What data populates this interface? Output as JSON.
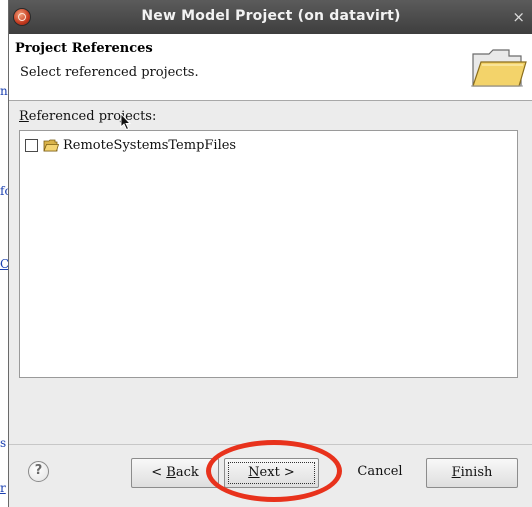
{
  "window": {
    "title": "New Model Project  (on datavirt)",
    "close_glyph": "×"
  },
  "header": {
    "title": "Project References",
    "description": "Select referenced projects."
  },
  "content": {
    "label_mnemonic": "R",
    "label_rest": "eferenced projects:",
    "projects": [
      {
        "name": "RemoteSystemsTempFiles",
        "checked": false
      }
    ]
  },
  "buttons": {
    "help": "?",
    "back_prefix": "< ",
    "back_mnemonic": "B",
    "back_rest": "ack",
    "next_mnemonic": "N",
    "next_rest": "ext >",
    "cancel": "Cancel",
    "finish_mnemonic": "F",
    "finish_rest": "inish"
  },
  "background": {
    "fragments": [
      "n",
      "fo",
      "C",
      "s",
      "r"
    ]
  },
  "colors": {
    "annotation": "#e8321c",
    "titlebar": "#4a4a4a"
  }
}
